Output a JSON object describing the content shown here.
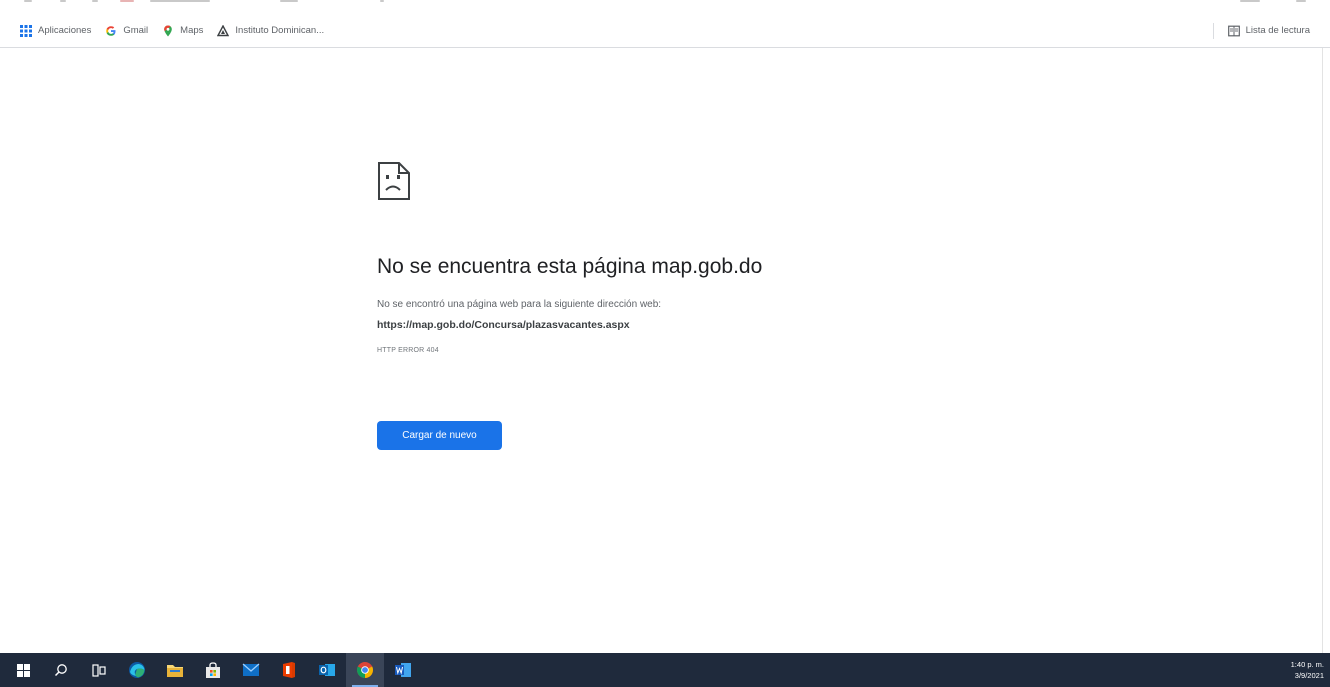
{
  "bookmarks": [
    {
      "label": "Aplicaciones",
      "icon": "apps-grid-icon"
    },
    {
      "label": "Gmail",
      "icon": "google-g-icon"
    },
    {
      "label": "Maps",
      "icon": "maps-pin-icon"
    },
    {
      "label": "Instituto Dominican...",
      "icon": "triangle-logo-icon"
    }
  ],
  "reading_list": {
    "label": "Lista de lectura",
    "icon": "reading-list-icon"
  },
  "error_page": {
    "icon": "sad-file-icon",
    "title": "No se encuentra esta página map.gob.do",
    "description": "No se encontró una página web para la siguiente dirección web:",
    "url": "https://map.gob.do/Concursa/plazasvacantes.aspx",
    "code": "HTTP ERROR 404",
    "reload_label": "Cargar de nuevo"
  },
  "taskbar": {
    "apps": [
      {
        "name": "windows-start",
        "icon": "windows-start-icon"
      },
      {
        "name": "search",
        "icon": "search-icon"
      },
      {
        "name": "task-view",
        "icon": "task-view-icon"
      },
      {
        "name": "edge",
        "icon": "edge-browser-icon"
      },
      {
        "name": "file-explorer",
        "icon": "folder-icon"
      },
      {
        "name": "store",
        "icon": "store-bag-icon"
      },
      {
        "name": "mail",
        "icon": "mail-icon"
      },
      {
        "name": "office",
        "icon": "office-icon"
      },
      {
        "name": "outlook",
        "icon": "outlook-icon"
      },
      {
        "name": "chrome",
        "icon": "chrome-icon"
      },
      {
        "name": "word",
        "icon": "word-icon"
      }
    ],
    "clock": {
      "time": "1:40 p. m.",
      "date": "3/9/2021"
    }
  },
  "colors": {
    "accent": "#1a73e8",
    "taskbar_bg": "#1f2a3c",
    "title_text": "#202124",
    "secondary_text": "#5f6368"
  }
}
